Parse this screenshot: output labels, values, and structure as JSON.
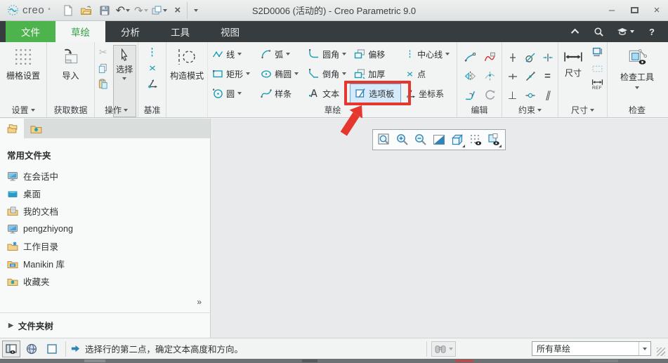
{
  "window": {
    "logo_text": "creo",
    "logo_mark": "°",
    "title": "S2D0006 (活动的) - Creo Parametric 9.0"
  },
  "icons": {
    "undo": "↶",
    "redo": "↷",
    "scissors": "✂",
    "close": "×",
    "minimize": "–",
    "help": "?",
    "chevron_double": "»",
    "expander": "▶",
    "caret": "▾",
    "perpendicular": "⊥",
    "parallel": "∥",
    "equal": "="
  },
  "tabs": [
    {
      "label": "文件"
    },
    {
      "label": "草绘"
    },
    {
      "label": "分析"
    },
    {
      "label": "工具"
    },
    {
      "label": "视图"
    }
  ],
  "ribbon": {
    "groups": {
      "settings": {
        "label": "设置",
        "button": "栅格设置"
      },
      "get_data": {
        "label": "获取数据",
        "button": "导入"
      },
      "operations": {
        "label": "操作",
        "select_button": "选择"
      },
      "datum": {
        "label": "基准"
      },
      "sketch": {
        "label": "草绘",
        "construction_button": "构造模式",
        "tools": [
          {
            "label": "线"
          },
          {
            "label": "矩形"
          },
          {
            "label": "圆"
          },
          {
            "label": "弧"
          },
          {
            "label": "椭圆"
          },
          {
            "label": "样条"
          },
          {
            "label": "圆角"
          },
          {
            "label": "倒角"
          },
          {
            "label": "文本"
          },
          {
            "label": "偏移"
          },
          {
            "label": "加厚"
          },
          {
            "label": "选项板"
          },
          {
            "label": "中心线"
          },
          {
            "label": "点"
          },
          {
            "label": "坐标系"
          }
        ]
      },
      "edit": {
        "label": "编辑"
      },
      "constraints": {
        "label": "约束"
      },
      "dimension": {
        "label": "尺寸",
        "button": "尺寸",
        "ref_label": "REF"
      },
      "inspect": {
        "label": "检查",
        "button": "检查工具"
      }
    }
  },
  "navigator": {
    "header": "常用文件夹",
    "items": [
      {
        "label": "在会话中"
      },
      {
        "label": "桌面"
      },
      {
        "label": "我的文档"
      },
      {
        "label": "pengzhiyong"
      },
      {
        "label": "工作目录"
      },
      {
        "label": "Manikin 库"
      },
      {
        "label": "收藏夹"
      }
    ],
    "footer": "文件夹树"
  },
  "statusbar": {
    "message": "选择行的第二点，确定文本高度和方向。",
    "filter_value": "所有草绘"
  },
  "colors": {
    "accent_teal": "#1b9eb3",
    "tab_green": "#4db34d",
    "highlight_red": "#e5372e",
    "selection_blue_bg": "#d5eafa",
    "selection_blue_border": "#6fa8d2",
    "canvas_grey": "#e8eaec"
  }
}
